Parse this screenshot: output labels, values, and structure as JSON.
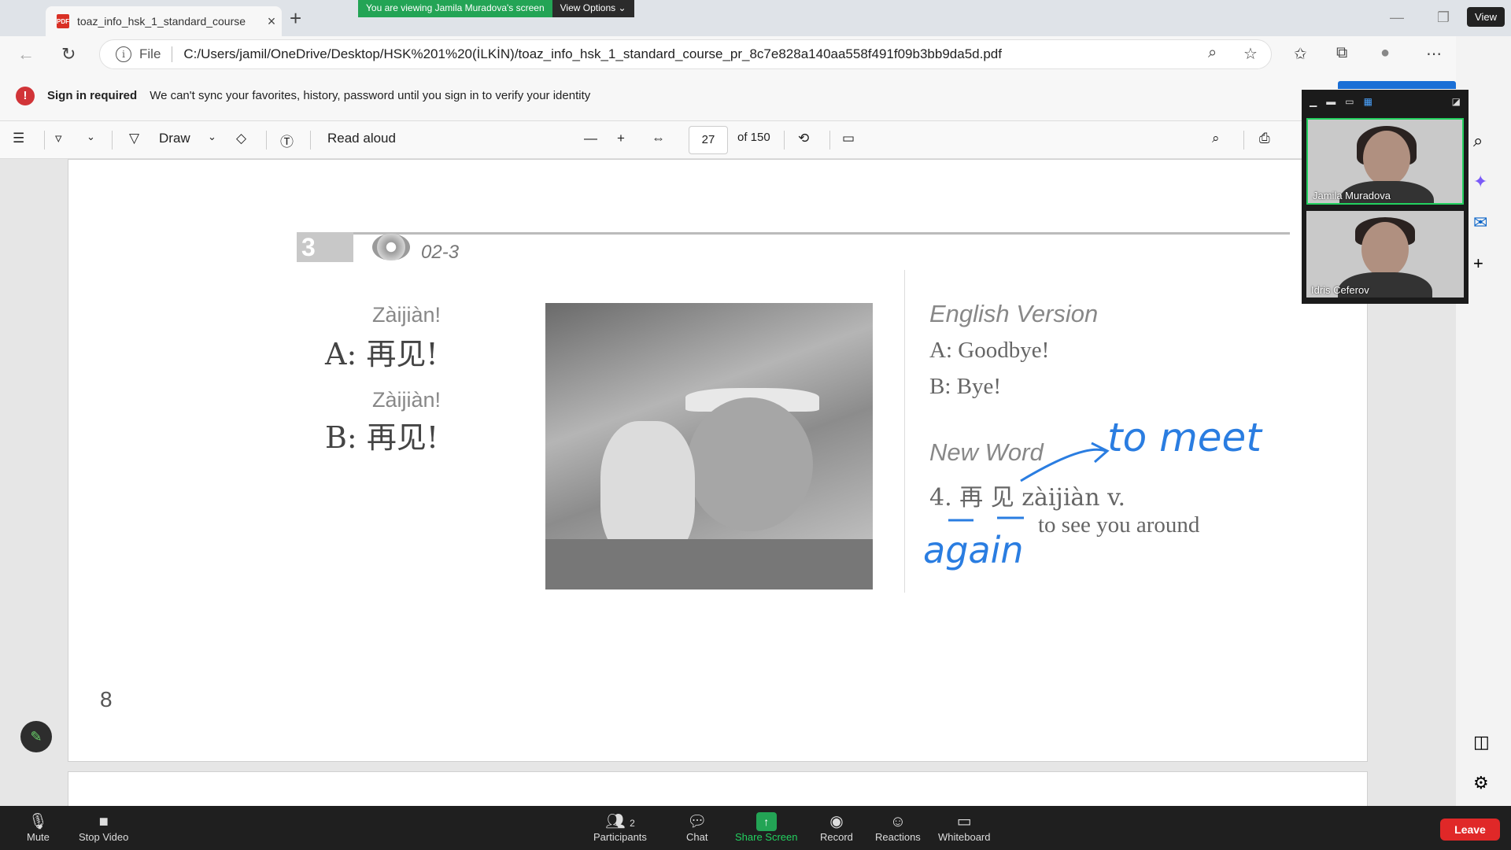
{
  "browser": {
    "tab_title": "toaz_info_hsk_1_standard_course",
    "tab_icon": "PDF",
    "view_button": "View",
    "url_scheme": "File",
    "url": "C:/Users/jamil/OneDrive/Desktop/HSK%201%20(İLKİN)/toaz_info_hsk_1_standard_course_pr_8c7e828a140aa558f491f09b3bb9da5d.pdf"
  },
  "zoom_banner": {
    "viewing": "You are viewing Jamila Muradova's screen",
    "view_options": "View Options ⌄"
  },
  "signin": {
    "title": "Sign in required",
    "message": "We can't sync your favorites, history, password until you sign in to verify your identity"
  },
  "pdf_toolbar": {
    "draw": "Draw",
    "read_aloud": "Read aloud",
    "page": "27",
    "of_pages": "of 150"
  },
  "document": {
    "section_number": "3",
    "track": "02-3",
    "dialog": [
      {
        "pinyin": "Zàijiàn!",
        "speaker": "A:",
        "hanzi": "再见!"
      },
      {
        "pinyin": "Zàijiàn!",
        "speaker": "B:",
        "hanzi": "再见!"
      }
    ],
    "english_title": "English Version",
    "english_lines": [
      "A: Goodbye!",
      "B: Bye!"
    ],
    "new_word_title": "New Word",
    "new_word_entry": "4. 再 见  zàijiàn  v.",
    "new_word_def": "to see you around",
    "page_number": "8",
    "handwriting_1": "to meet",
    "handwriting_2": "again"
  },
  "participants": [
    {
      "name": "Jamila Muradova"
    },
    {
      "name": "Idris Ceferov"
    }
  ],
  "zoom_controls": {
    "mute": "Mute",
    "stop_video": "Stop Video",
    "participants": "Participants",
    "participants_count": "2",
    "chat": "Chat",
    "share_screen": "Share Screen",
    "record": "Record",
    "reactions": "Reactions",
    "whiteboard": "Whiteboard",
    "leave": "Leave"
  },
  "colors": {
    "accent_green": "#23a455",
    "ink_blue": "#2a7de1",
    "leave_red": "#e02828",
    "error_red": "#d13438"
  }
}
